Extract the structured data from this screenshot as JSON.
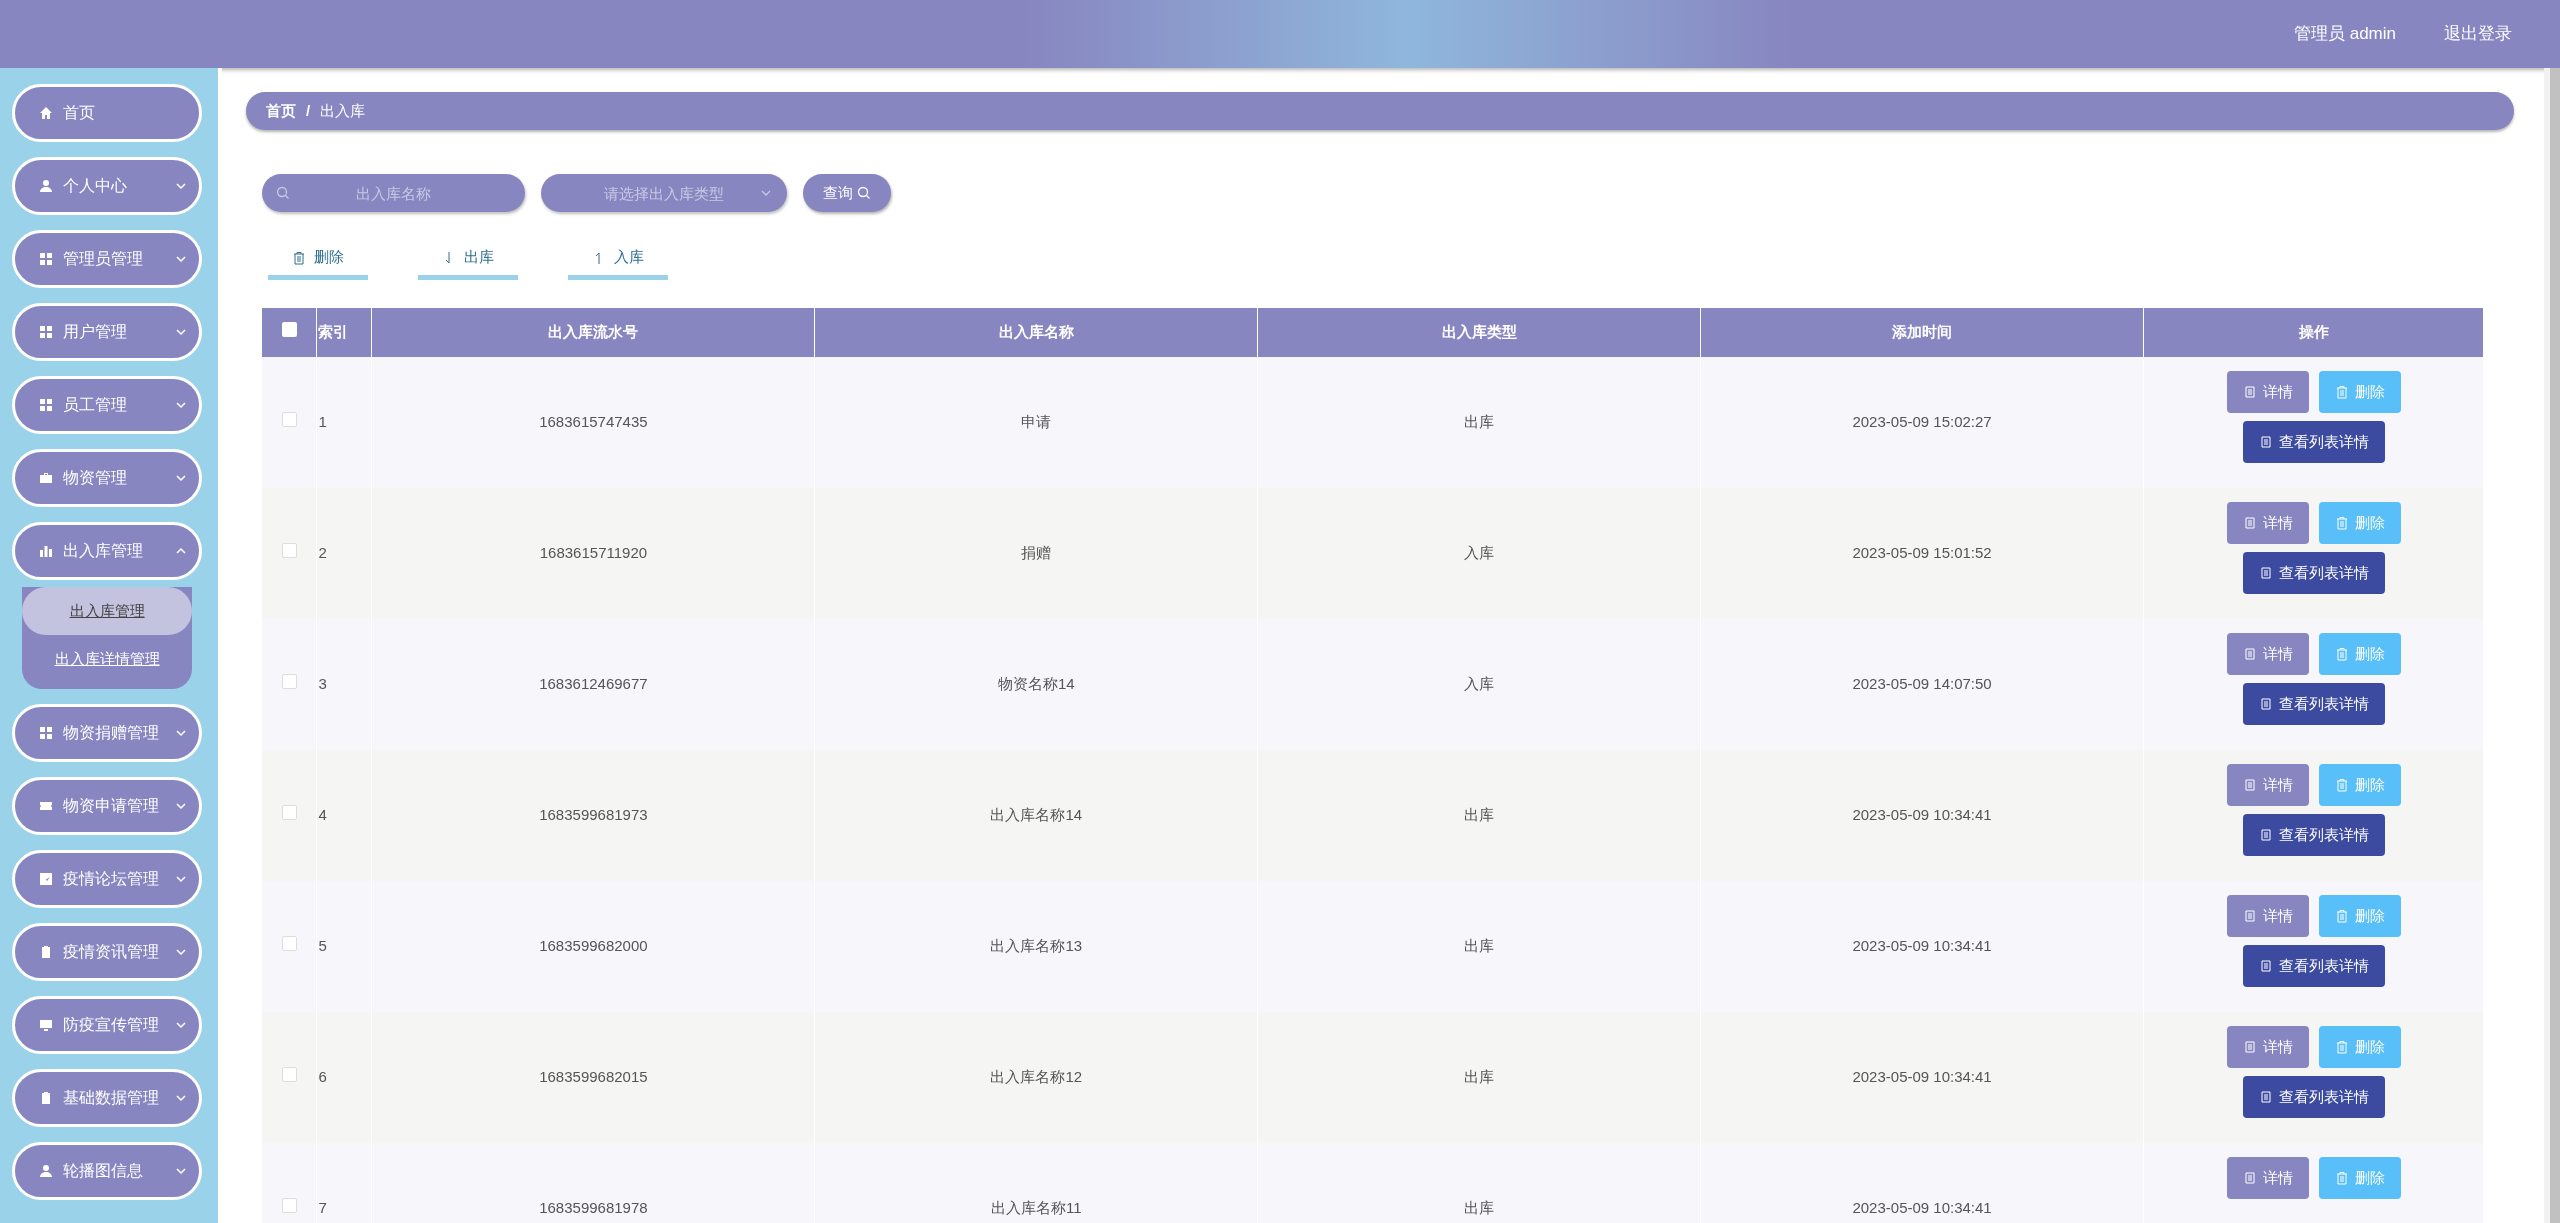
{
  "header": {
    "user": "管理员 admin",
    "logout": "退出登录"
  },
  "sidebar": {
    "items": [
      {
        "label": "首页"
      },
      {
        "label": "个人中心",
        "expanded": false
      },
      {
        "label": "管理员管理",
        "expanded": false
      },
      {
        "label": "用户管理",
        "expanded": false
      },
      {
        "label": "员工管理",
        "expanded": false
      },
      {
        "label": "物资管理",
        "expanded": false
      },
      {
        "label": "出入库管理",
        "expanded": true,
        "children": [
          {
            "label": "出入库管理",
            "selected": true
          },
          {
            "label": "出入库详情管理",
            "selected": false
          }
        ]
      },
      {
        "label": "物资捐赠管理",
        "expanded": false
      },
      {
        "label": "物资申请管理",
        "expanded": false
      },
      {
        "label": "疫情论坛管理",
        "expanded": false
      },
      {
        "label": "疫情资讯管理",
        "expanded": false
      },
      {
        "label": "防疫宣传管理",
        "expanded": false
      },
      {
        "label": "基础数据管理",
        "expanded": false
      },
      {
        "label": "轮播图信息",
        "expanded": false
      }
    ]
  },
  "breadcrumb": {
    "items": [
      "首页",
      "出入库"
    ],
    "separator": "/"
  },
  "search": {
    "name_placeholder": "出入库名称",
    "type_placeholder": "请选择出入库类型",
    "button": "查询"
  },
  "toolbar": [
    {
      "label": "删除"
    },
    {
      "label": "出库"
    },
    {
      "label": "入库"
    }
  ],
  "table": {
    "all_checked": false,
    "columns": [
      "索引",
      "出入库流水号",
      "出入库名称",
      "出入库类型",
      "添加时间",
      "操作"
    ],
    "rows": [
      {
        "index": "1",
        "serial": "1683615747435",
        "name": "申请",
        "type": "出库",
        "time": "2023-05-09 15:02:27",
        "checked": false,
        "actions": [
          "详情",
          "删除",
          "查看列表详情"
        ]
      },
      {
        "index": "2",
        "serial": "1683615711920",
        "name": "捐赠",
        "type": "入库",
        "time": "2023-05-09 15:01:52",
        "checked": false,
        "actions": [
          "详情",
          "删除",
          "查看列表详情"
        ]
      },
      {
        "index": "3",
        "serial": "1683612469677",
        "name": "物资名称14",
        "type": "入库",
        "time": "2023-05-09 14:07:50",
        "checked": false,
        "actions": [
          "详情",
          "删除",
          "查看列表详情"
        ]
      },
      {
        "index": "4",
        "serial": "1683599681973",
        "name": "出入库名称14",
        "type": "出库",
        "time": "2023-05-09 10:34:41",
        "checked": false,
        "actions": [
          "详情",
          "删除",
          "查看列表详情"
        ]
      },
      {
        "index": "5",
        "serial": "1683599682000",
        "name": "出入库名称13",
        "type": "出库",
        "time": "2023-05-09 10:34:41",
        "checked": false,
        "actions": [
          "详情",
          "删除",
          "查看列表详情"
        ]
      },
      {
        "index": "6",
        "serial": "1683599682015",
        "name": "出入库名称12",
        "type": "出库",
        "time": "2023-05-09 10:34:41",
        "checked": false,
        "actions": [
          "详情",
          "删除",
          "查看列表详情"
        ]
      },
      {
        "index": "7",
        "serial": "1683599681978",
        "name": "出入库名称11",
        "type": "出库",
        "time": "2023-05-09 10:34:41",
        "checked": false,
        "actions": [
          "详情",
          "删除"
        ]
      }
    ]
  }
}
